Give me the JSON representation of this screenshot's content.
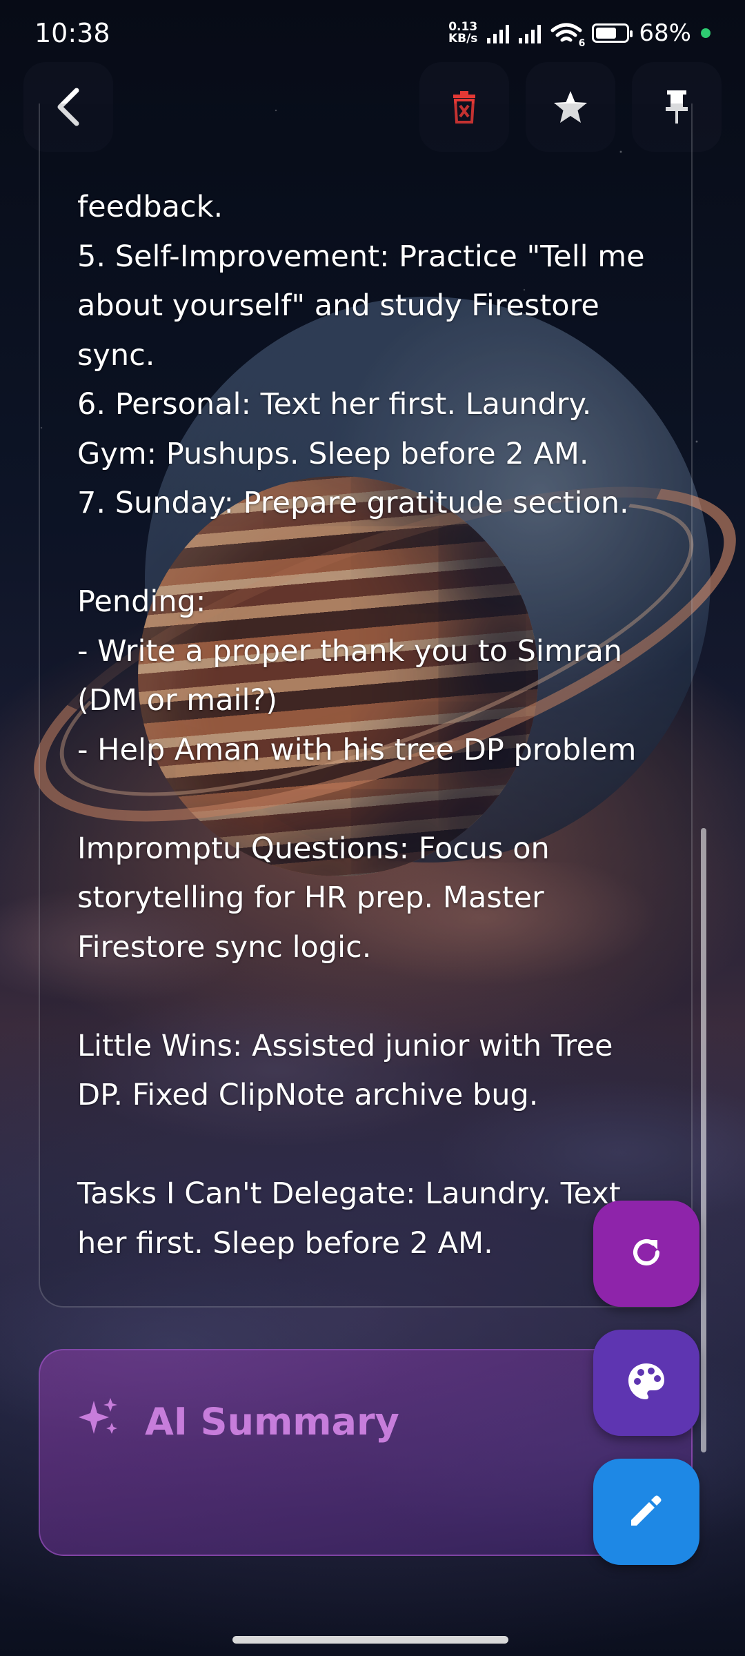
{
  "status_bar": {
    "time": "10:38",
    "net_speed_value": "0.13",
    "net_speed_unit": "KB/s",
    "wifi_badge": "6",
    "battery": "68%",
    "battery_level": 0.68
  },
  "toolbar": {
    "back_icon": "chevron-left-icon",
    "delete_icon": "delete-icon",
    "star_icon": "star-icon",
    "pin_icon": "pin-icon",
    "delete_color": "#e53935"
  },
  "note": {
    "lines": [
      "feedback.",
      "5. Self-Improvement: Practice \"Tell me",
      "about yourself\" and study Firestore",
      "sync.",
      "6. Personal: Text her first. Laundry.",
      "Gym: Pushups. Sleep before 2 AM.",
      "7. Sunday: Prepare gratitude section.",
      "",
      "Pending:",
      "- Write a proper thank you to Simran",
      "(DM or mail?)",
      "- Help Aman with his tree DP problem",
      "",
      "Impromptu Questions: Focus on",
      "storytelling for HR prep. Master",
      "Firestore sync logic.",
      "",
      "Little Wins: Assisted junior with Tree",
      "DP. Fixed ClipNote archive bug.",
      "",
      "Tasks I Can't Delegate: Laundry. Text",
      "her first. Sleep before 2 AM."
    ]
  },
  "ai_summary": {
    "title": "AI Summary",
    "icon": "sparkles-icon",
    "accent": "#c77ddb"
  },
  "fabs": {
    "refresh": {
      "icon": "refresh-icon",
      "color": "#8e24aa"
    },
    "palette": {
      "icon": "palette-icon",
      "color": "#5e35b1"
    },
    "edit": {
      "icon": "pencil-icon",
      "color": "#1e88e5"
    }
  }
}
